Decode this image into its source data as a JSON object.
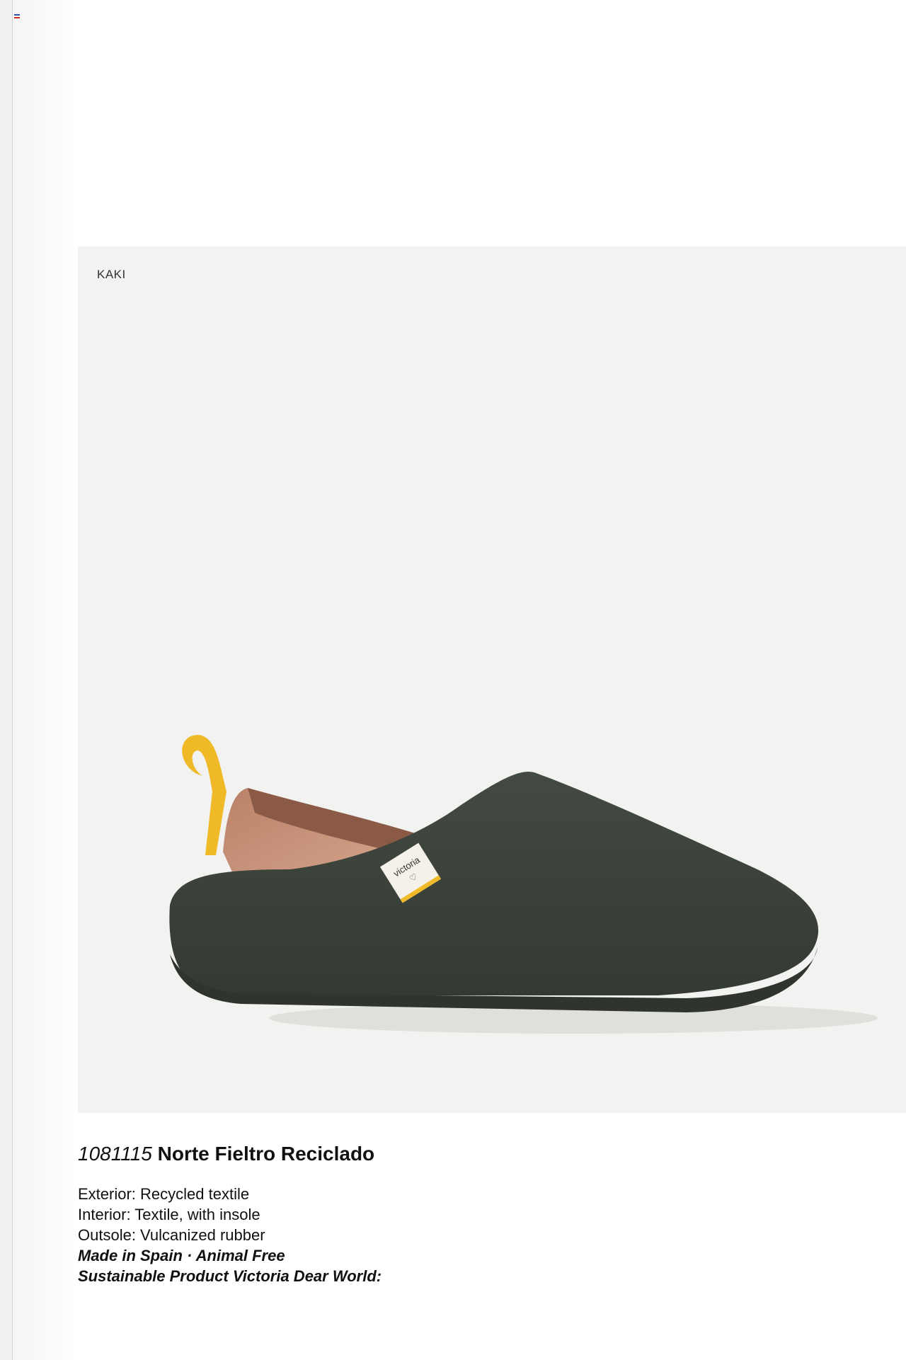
{
  "page": {
    "accent_colors": {
      "rail": "#f0f0f0",
      "card": "#f2f2f1",
      "text": "#111111"
    }
  },
  "product": {
    "color_label": "KAKI",
    "code": "1081115",
    "name": "Norte Fieltro Reciclado",
    "image_label": "victoria",
    "specs": [
      "Exterior: Recycled textile",
      "Interior: Textile, with insole",
      "Outsole: Vulcanized rubber"
    ],
    "tags": [
      "Made in Spain · Animal Free",
      "Sustainable Product Victoria Dear World:"
    ],
    "shoe_colors": {
      "felt": "#3a4139",
      "sole": "#434a41",
      "lining": "#c8937a",
      "pull_tab": "#f0b928",
      "label": "#f4f1e8"
    }
  }
}
